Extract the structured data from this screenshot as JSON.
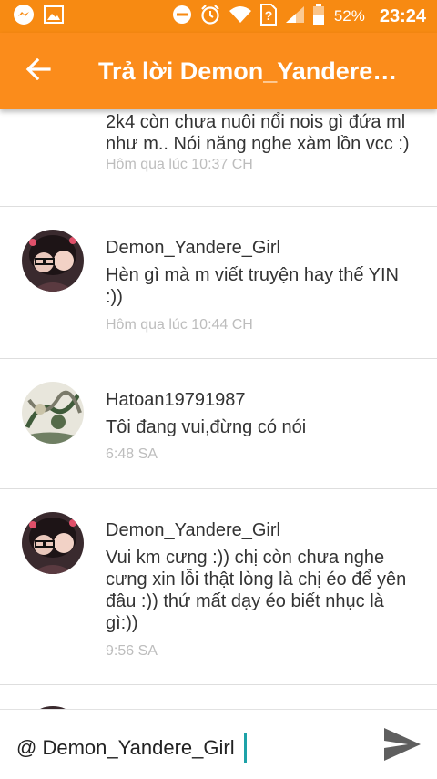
{
  "status_bar": {
    "battery_percent": "52%",
    "time": "23:24",
    "icons": [
      "messenger-icon",
      "image-icon",
      "do-not-disturb-icon",
      "alarm-icon",
      "wifi-icon",
      "no-sim-icon",
      "signal-icon",
      "battery-icon"
    ]
  },
  "header": {
    "title": "Trả lời Demon_Yandere…",
    "back_icon": "arrow-left-icon"
  },
  "comments": [
    {
      "message": "2k4 còn chưa nuôi nổi nois gì đứa ml như m..  Nói năng nghe xàm lồn vcc :)",
      "time": "Hôm qua lúc 10:37 CH"
    },
    {
      "username": "Demon_Yandere_Girl",
      "message": "Hèn gì mà m viết truyện hay thế YIN :))",
      "time": "Hôm qua lúc 10:44 CH"
    },
    {
      "username": "Hatoan19791987",
      "message": "Tôi đang vui,đừng có nói",
      "time": "6:48 SA"
    },
    {
      "username": "Demon_Yandere_Girl",
      "message": "Vui km cưng :)) chị còn chưa nghe cưng xin lỗi thật lòng là chị éo để yên đâu :)) thứ mất dạy éo biết nhục là gì:))",
      "time": "9:56 SA"
    }
  ],
  "reply_box": {
    "value": "@ Demon_Yandere_Girl",
    "send_icon": "send-icon"
  },
  "colors": {
    "appbar": "#fb8c1b",
    "statusbar": "#f78a12",
    "timestamp": "#bdbdbd",
    "caret": "#1ea2a8"
  }
}
